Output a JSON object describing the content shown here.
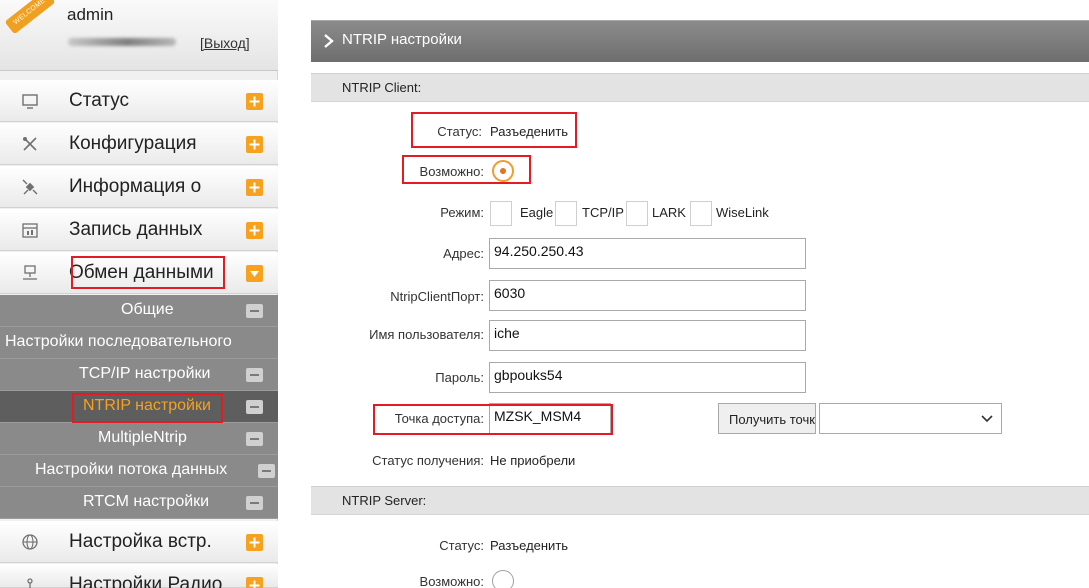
{
  "user": {
    "badge": "WELCOME",
    "name": "admin",
    "logout": "[Выход]"
  },
  "sidebar": {
    "items": [
      {
        "label": "Статус",
        "icon": "monitor-icon"
      },
      {
        "label": "Конфигурация",
        "icon": "tools-icon"
      },
      {
        "label": "Информация о",
        "icon": "satellite-icon"
      },
      {
        "label": "Запись данных",
        "icon": "calendar-icon"
      },
      {
        "label": "Обмен данными",
        "icon": "network-icon",
        "expanded": true
      },
      {
        "label": "Настройка встр.",
        "icon": "globe-icon"
      },
      {
        "label": "Настройки Радио",
        "icon": "antenna-icon"
      }
    ],
    "subitems": [
      {
        "label": "Общие"
      },
      {
        "label": "Настройки последовательного"
      },
      {
        "label": "TCP/IP настройки"
      },
      {
        "label": "NTRIP настройки",
        "active": true
      },
      {
        "label": "MultipleNtrip"
      },
      {
        "label": "Настройки потока данных"
      },
      {
        "label": "RTCM настройки"
      }
    ]
  },
  "main": {
    "title": "NTRIP настройки",
    "client": {
      "header": "NTRIP Client:",
      "status_label": "Статус:",
      "status_value": "Разъеденить",
      "enable_label": "Возможно:",
      "enable_checked": true,
      "mode_label": "Режим:",
      "modes": [
        "Eagle",
        "TCP/IP",
        "LARK",
        "WiseLink"
      ],
      "address_label": "Адрес:",
      "address_value": "94.250.250.43",
      "port_label": "NtripClientПорт:",
      "port_value": "6030",
      "user_label": "Имя пользователя:",
      "user_value": "iche",
      "password_label": "Пароль:",
      "password_value": "gbpouks54",
      "mount_label": "Точка доступа:",
      "mount_value": "MZSK_MSM4",
      "get_button": "Получить точки",
      "mount_select_value": "",
      "fetch_label": "Статус получения:",
      "fetch_value": "Не приобрели"
    },
    "server": {
      "header": "NTRIP Server:",
      "status_label": "Статус:",
      "status_value": "Разъеденить",
      "enable_label": "Возможно:",
      "enable_checked": false
    }
  },
  "colors": {
    "accent": "#f7a21f",
    "highlight": "#e41b23",
    "submenu": "#8a8a8a",
    "submenu_active": "#5e5e5e",
    "active_text": "#f7a21f"
  }
}
